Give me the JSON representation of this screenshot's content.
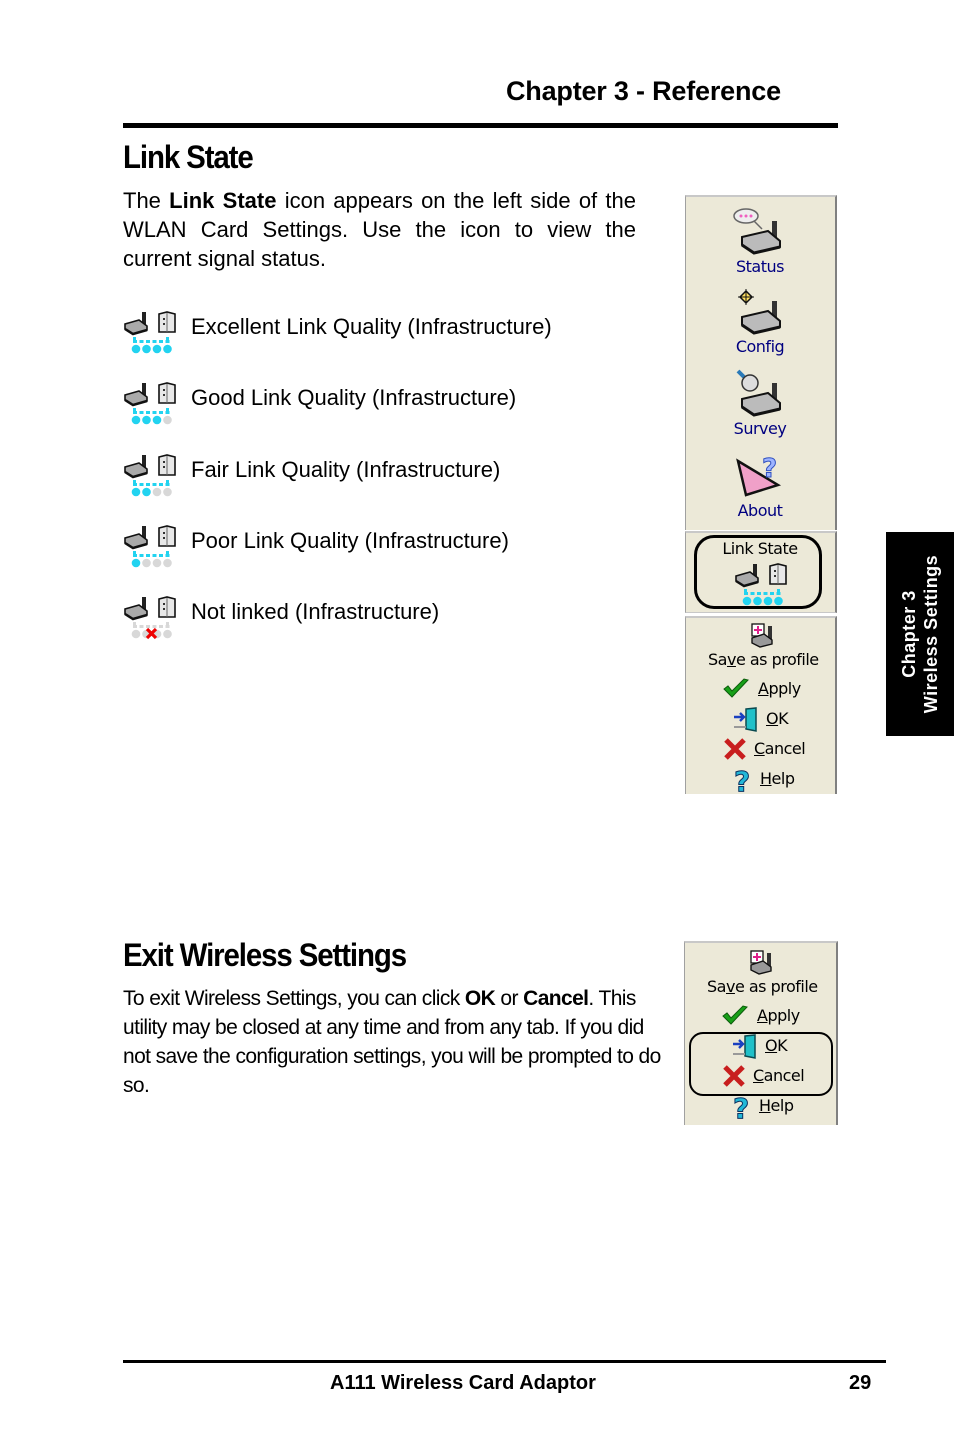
{
  "header": {
    "chapter": "Chapter 3 - Reference"
  },
  "link_state": {
    "title": "Link State",
    "intro": {
      "pre": "The ",
      "bold": "Link State",
      "post": " icon appears on the left side of the WLAN Card Settings. Use the icon to view the current signal status."
    },
    "legend": [
      {
        "label": "Excellent Link Quality (Infrastructure)",
        "signal_dots": 4,
        "linked": true
      },
      {
        "label": "Good Link Quality (Infrastructure)",
        "signal_dots": 3,
        "linked": true
      },
      {
        "label": "Fair Link Quality (Infrastructure)",
        "signal_dots": 2,
        "linked": true
      },
      {
        "label": "Poor Link Quality (Infrastructure)",
        "signal_dots": 1,
        "linked": true
      },
      {
        "label": "Not linked (Infrastructure)",
        "signal_dots": 0,
        "linked": false
      }
    ]
  },
  "screenshot_panel": {
    "nav": [
      {
        "label": "Status",
        "icon": "status-router-icon"
      },
      {
        "label": "Config",
        "icon": "config-router-icon"
      },
      {
        "label": "Survey",
        "icon": "survey-router-icon"
      },
      {
        "label": "About",
        "icon": "about-icon"
      }
    ],
    "link_state_label": "Link State",
    "actions": {
      "save_pre": "Sa",
      "save_u": "v",
      "save_post": "e as profile",
      "apply_u": "A",
      "apply_post": "pply",
      "ok_u": "O",
      "ok_post": "K",
      "cancel_u": "C",
      "cancel_post": "ancel",
      "help_u": "H",
      "help_post": "elp"
    }
  },
  "exit": {
    "title": "Exit Wireless Settings",
    "body": {
      "p1": "To exit Wireless Settings, you can click ",
      "ok": "OK",
      "p2": " or ",
      "cancel": "Cancel",
      "p3": ". This utility may be closed at any time and from any tab. If you did not save the configuration settings, you will be prompted to do so."
    }
  },
  "side_tab": {
    "line1": "Chapter 3",
    "line2": "Wireless Settings"
  },
  "footer": {
    "title": "A111 Wireless Card Adaptor",
    "page": "29"
  },
  "colors": {
    "signal_on": "#22d3f0",
    "signal_off": "#d8d8d8",
    "nav_text": "#000080",
    "panel_bg": "#ece9d8"
  }
}
